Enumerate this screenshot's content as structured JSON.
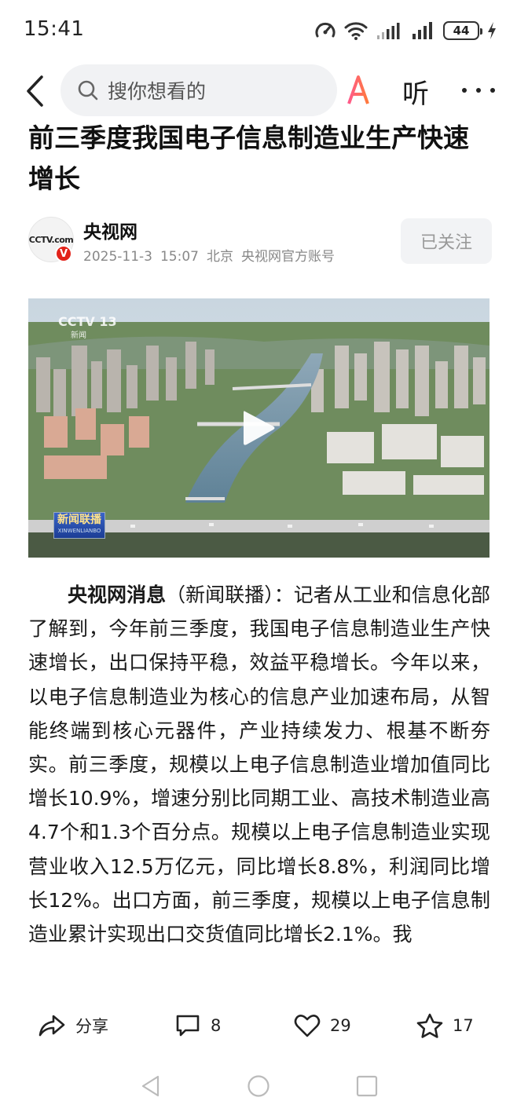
{
  "status_bar": {
    "time": "15:41",
    "battery": "44",
    "icons": [
      "speed-icon",
      "wifi-icon",
      "signal-icon",
      "signal-icon",
      "battery-icon",
      "charging-icon"
    ]
  },
  "nav": {
    "back_icon": "back-arrow-icon",
    "search_placeholder": "搜你想看的",
    "ai_label": "AI",
    "listen_label": "听",
    "more_icon": "more-dots-icon"
  },
  "article": {
    "title": "前三季度我国电子信息制造业生产快速增长",
    "author": {
      "name": "央视网",
      "avatar_text": "CCTV.com",
      "verified": "V",
      "date": "2025-11-3",
      "time": "15:07",
      "location": "北京",
      "account_type": "央视网官方账号",
      "follow_label": "已关注"
    },
    "video": {
      "channel_watermark": "CCTV 13",
      "channel_sub": "新闻",
      "program_badge": "新闻联播",
      "program_badge_sub": "XINWENLIANBO"
    },
    "body_lead": "央视网消息",
    "body_text": "（新闻联播）：记者从工业和信息化部了解到，今年前三季度，我国电子信息制造业生产快速增长，出口保持平稳，效益平稳增长。今年以来，以电子信息制造业为核心的信息产业加速布局，从智能终端到核心元器件，产业持续发力、根基不断夯实。前三季度，规模以上电子信息制造业增加值同比增长10.9%，增速分别比同期工业、高技术制造业高4.7个和1.3个百分点。规模以上电子信息制造业实现营业收入12.5万亿元，同比增长8.8%，利润同比增长12%。出口方面，前三季度，规模以上电子信息制造业累计实现出口交货值同比增长2.1%。我"
  },
  "actions": {
    "share_label": "分享",
    "comments_count": "8",
    "likes_count": "29",
    "favorites_count": "17"
  },
  "colors": {
    "accent_red": "#e2231a",
    "ai_gradient_start": "#ff5a8a",
    "ai_gradient_end": "#ff7a3d"
  }
}
